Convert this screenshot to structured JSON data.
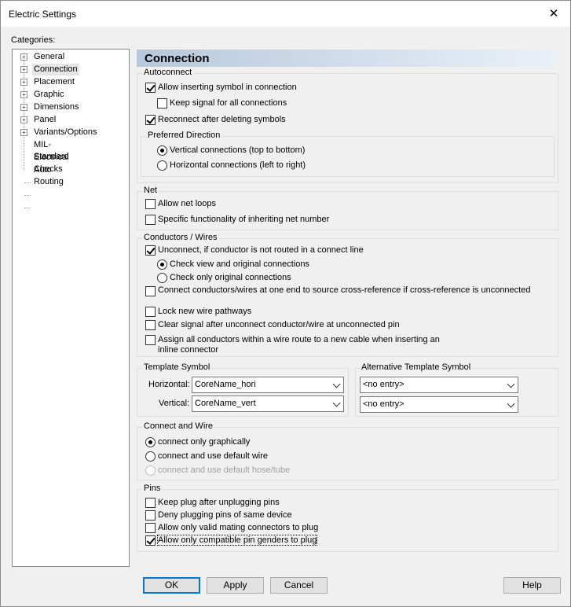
{
  "window": {
    "title": "Electric Settings",
    "close_glyph": "✕"
  },
  "sidebar": {
    "label": "Categories:",
    "items": [
      {
        "label": "General",
        "expander": "+"
      },
      {
        "label": "Connection",
        "expander": "+"
      },
      {
        "label": "Placement",
        "expander": "+"
      },
      {
        "label": "Graphic",
        "expander": "+"
      },
      {
        "label": "Dimensions",
        "expander": "+"
      },
      {
        "label": "Panel",
        "expander": "+"
      },
      {
        "label": "Variants/Options",
        "expander": "+"
      },
      {
        "label": "MIL-Standard",
        "expander": ""
      },
      {
        "label": "Electrical Checks",
        "expander": ""
      },
      {
        "label": "Auto Routing",
        "expander": ""
      }
    ],
    "selected": "Connection"
  },
  "header": {
    "title": "Connection"
  },
  "autoconnect": {
    "title": "Autoconnect",
    "allow_inserting": {
      "label": "Allow inserting symbol in connection",
      "checked": true
    },
    "keep_signal": {
      "label": "Keep signal for all connections",
      "checked": false
    },
    "reconnect": {
      "label": "Reconnect after deleting symbols",
      "checked": true
    },
    "preferred_direction": {
      "title": "Preferred Direction",
      "vertical": {
        "label": "Vertical connections (top to bottom)",
        "selected": true
      },
      "horizontal": {
        "label": "Horizontal connections (left to right)",
        "selected": false
      }
    }
  },
  "net": {
    "title": "Net",
    "allow_loops": {
      "label": "Allow net loops",
      "checked": false
    },
    "specific_func": {
      "label": "Specific functionality of inheriting net number",
      "checked": false
    }
  },
  "conductors": {
    "title": "Conductors / Wires",
    "unconnect": {
      "label": "Unconnect, if conductor is not routed in a connect line",
      "checked": true
    },
    "check_view": {
      "label": "Check view and original connections",
      "selected": true
    },
    "check_original": {
      "label": "Check only original connections",
      "selected": false
    },
    "connect_one_end": {
      "label": "Connect conductors/wires at one end to source cross-reference if cross-reference is unconnected",
      "checked": false
    },
    "lock_pathways": {
      "label": "Lock new wire pathways",
      "checked": false
    },
    "clear_signal": {
      "label": "Clear signal after unconnect conductor/wire at unconnected pin",
      "checked": false
    },
    "assign_line1": "Assign all conductors within a wire route to a new cable when inserting an",
    "assign_line2": "inline connector",
    "assign_checked": false
  },
  "template_symbol": {
    "title": "Template Symbol",
    "horizontal_label": "Horizontal:",
    "horizontal_value": "CoreName_hori",
    "vertical_label": "Vertical:",
    "vertical_value": "CoreName_vert"
  },
  "alt_template_symbol": {
    "title": "Alternative Template Symbol",
    "value1": "<no entry>",
    "value2": "<no entry>"
  },
  "connect_wire": {
    "title": "Connect and Wire",
    "graphically": {
      "label": "connect only graphically",
      "selected": true
    },
    "default_wire": {
      "label": "connect and use default wire",
      "selected": false
    },
    "default_hose": {
      "label": "connect and use default hose/tube",
      "selected": false,
      "disabled": true
    }
  },
  "pins": {
    "title": "Pins",
    "keep_plug": {
      "label": "Keep plug after unplugging pins",
      "checked": false
    },
    "deny_plugging": {
      "label": "Deny plugging pins of same device",
      "checked": false
    },
    "valid_mating": {
      "label": "Allow only valid mating connectors to plug",
      "checked": false
    },
    "compatible_genders": {
      "label": "Allow only compatible pin genders to plug",
      "checked": true
    }
  },
  "footer": {
    "ok": "OK",
    "apply": "Apply",
    "cancel": "Cancel",
    "help": "Help"
  }
}
